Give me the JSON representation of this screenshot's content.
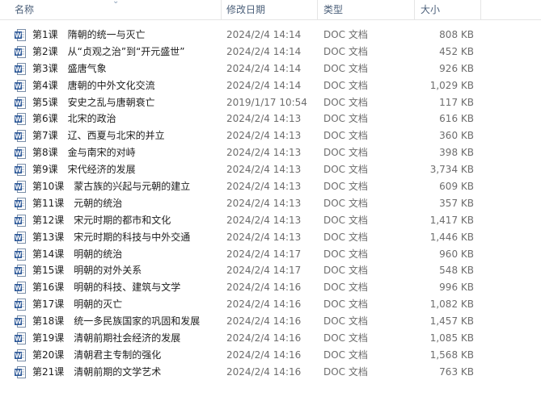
{
  "columns": {
    "name": "名称",
    "date": "修改日期",
    "type": "类型",
    "size": "大小"
  },
  "files": [
    {
      "name": "第1课　隋朝的统一与灭亡",
      "date": "2024/2/4 14:14",
      "type": "DOC 文档",
      "size": "808 KB"
    },
    {
      "name": "第2课　从“贞观之治”到“开元盛世”",
      "date": "2024/2/4 14:14",
      "type": "DOC 文档",
      "size": "452 KB"
    },
    {
      "name": "第3课　盛唐气象",
      "date": "2024/2/4 14:14",
      "type": "DOC 文档",
      "size": "926 KB"
    },
    {
      "name": "第4课　唐朝的中外文化交流",
      "date": "2024/2/4 14:14",
      "type": "DOC 文档",
      "size": "1,029 KB"
    },
    {
      "name": "第5课　安史之乱与唐朝衰亡",
      "date": "2019/1/17 10:54",
      "type": "DOC 文档",
      "size": "117 KB"
    },
    {
      "name": "第6课　北宋的政治",
      "date": "2024/2/4 14:13",
      "type": "DOC 文档",
      "size": "616 KB"
    },
    {
      "name": "第7课　辽、西夏与北宋的并立",
      "date": "2024/2/4 14:13",
      "type": "DOC 文档",
      "size": "360 KB"
    },
    {
      "name": "第8课　金与南宋的对峙",
      "date": "2024/2/4 14:13",
      "type": "DOC 文档",
      "size": "398 KB"
    },
    {
      "name": "第9课　宋代经济的发展",
      "date": "2024/2/4 14:13",
      "type": "DOC 文档",
      "size": "3,734 KB"
    },
    {
      "name": "第10课　蒙古族的兴起与元朝的建立",
      "date": "2024/2/4 14:13",
      "type": "DOC 文档",
      "size": "609 KB"
    },
    {
      "name": "第11课　元朝的统治",
      "date": "2024/2/4 14:13",
      "type": "DOC 文档",
      "size": "357 KB"
    },
    {
      "name": "第12课　宋元时期的都市和文化",
      "date": "2024/2/4 14:13",
      "type": "DOC 文档",
      "size": "1,417 KB"
    },
    {
      "name": "第13课　宋元时期的科技与中外交通",
      "date": "2024/2/4 14:13",
      "type": "DOC 文档",
      "size": "1,446 KB"
    },
    {
      "name": "第14课　明朝的统治",
      "date": "2024/2/4 14:17",
      "type": "DOC 文档",
      "size": "960 KB"
    },
    {
      "name": "第15课　明朝的对外关系",
      "date": "2024/2/4 14:17",
      "type": "DOC 文档",
      "size": "548 KB"
    },
    {
      "name": "第16课　明朝的科技、建筑与文学",
      "date": "2024/2/4 14:16",
      "type": "DOC 文档",
      "size": "996 KB"
    },
    {
      "name": "第17课　明朝的灭亡",
      "date": "2024/2/4 14:16",
      "type": "DOC 文档",
      "size": "1,082 KB"
    },
    {
      "name": "第18课　统一多民族国家的巩固和发展",
      "date": "2024/2/4 14:16",
      "type": "DOC 文档",
      "size": "1,457 KB"
    },
    {
      "name": "第19课　清朝前期社会经济的发展",
      "date": "2024/2/4 14:16",
      "type": "DOC 文档",
      "size": "1,085 KB"
    },
    {
      "name": "第20课　清朝君主专制的强化",
      "date": "2024/2/4 14:16",
      "type": "DOC 文档",
      "size": "1,568 KB"
    },
    {
      "name": "第21课　清朝前期的文学艺术",
      "date": "2024/2/4 14:16",
      "type": "DOC 文档",
      "size": "763 KB"
    }
  ],
  "icons": {
    "file": "word-document-icon",
    "sort": "sort-caret-icon"
  },
  "colors": {
    "header_text": "#4c607a",
    "icon_blue": "#2b5797"
  }
}
